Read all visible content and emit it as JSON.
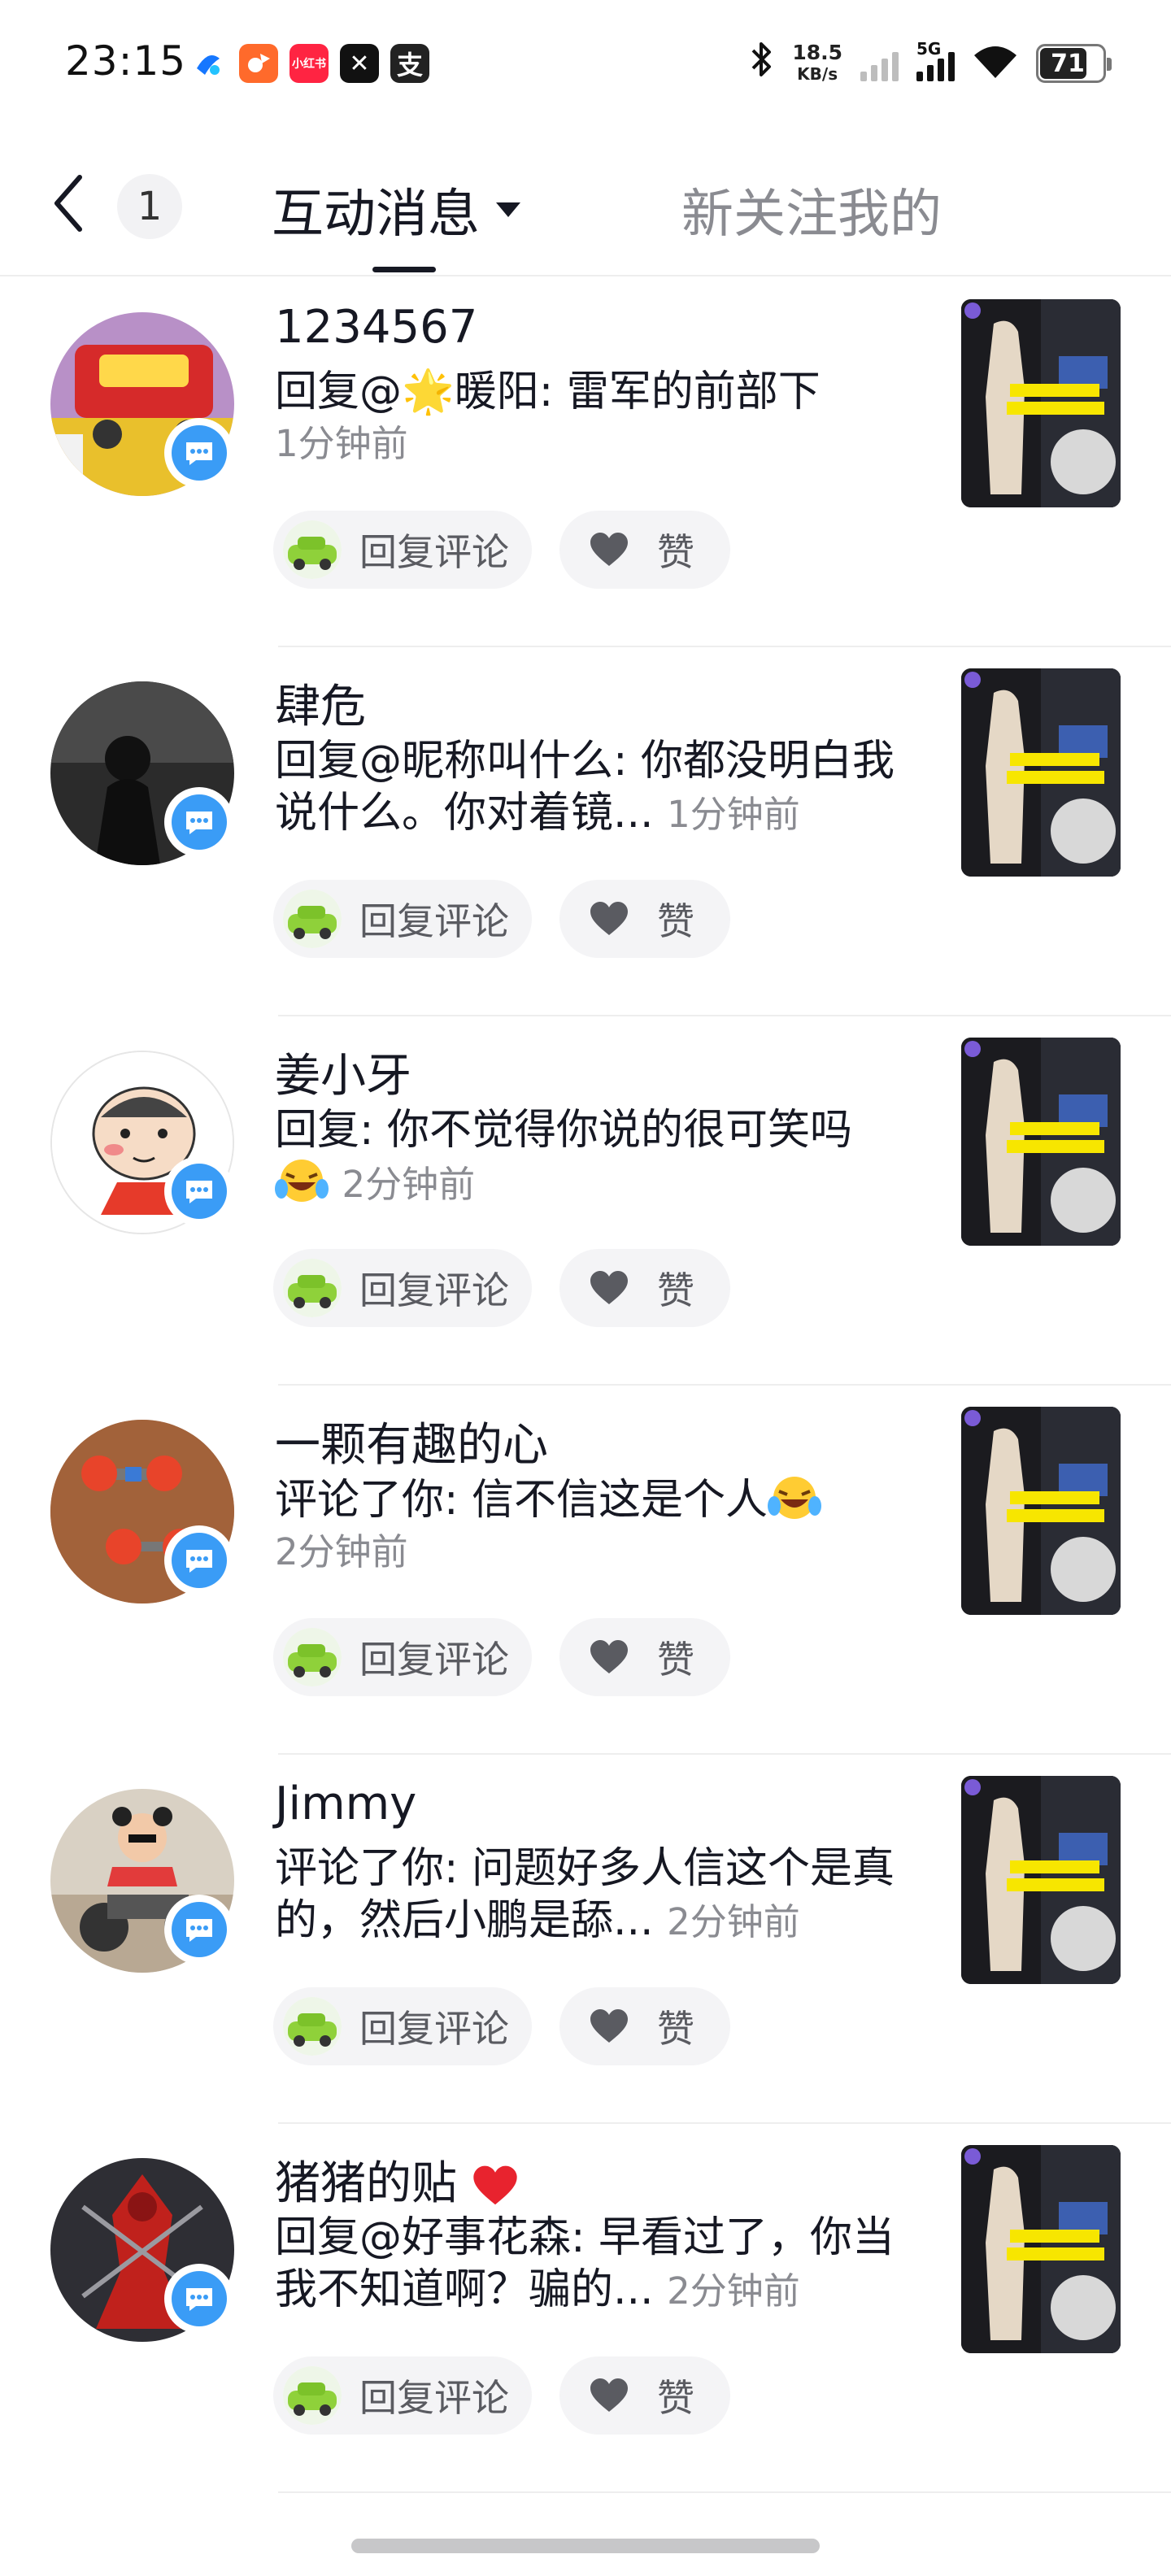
{
  "status_bar": {
    "time": "23:15",
    "apps": [
      {
        "name": "browser-app-icon",
        "label": "",
        "color": "#ffffff"
      },
      {
        "name": "orange-app-icon",
        "label": "",
        "color": "#ff6a2b"
      },
      {
        "name": "xiaohongshu-app-icon",
        "label": "小红书",
        "color": "#ff2442"
      },
      {
        "name": "capcut-app-icon",
        "label": "✕",
        "color": "#111111"
      },
      {
        "name": "alipay-app-icon",
        "label": "支",
        "color": "#222222"
      }
    ],
    "net_speed": "18.5",
    "net_unit": "KB/s",
    "network": "5G",
    "battery": "71"
  },
  "header": {
    "unread_count": "1",
    "tab_active": "互动消息",
    "tab_other": "新关注我的"
  },
  "actions": {
    "reply_label": "回复评论",
    "like_label": "赞"
  },
  "notifications": [
    {
      "username": "1234567",
      "comment": "回复@🌟暖阳: 雷军的前部下",
      "time": "1分钟前"
    },
    {
      "username": "肆危",
      "comment": "回复@昵称叫什么: 你都没明白我说什么。你对着镜...",
      "time": "1分钟前"
    },
    {
      "username": "姜小牙",
      "comment": "回复: 你不觉得你说的很可笑吗",
      "time": "2分钟前"
    },
    {
      "username": "一颗有趣的心",
      "comment": "评论了你: 信不信这是个人",
      "time": "2分钟前"
    },
    {
      "username": "Jimmy",
      "comment": "评论了你: 问题好多人信这个是真的，然后小鹏是舔...",
      "time": "2分钟前"
    },
    {
      "username": "猪猪的贴",
      "comment": "回复@好事花森: 早看过了，你当我不知道啊？骗的...",
      "time": "2分钟前"
    }
  ],
  "colors": {
    "accent_blue": "#3a9cf6",
    "text_primary": "#161823",
    "text_secondary": "#8a8b91",
    "button_bg": "#f4f4f6"
  }
}
